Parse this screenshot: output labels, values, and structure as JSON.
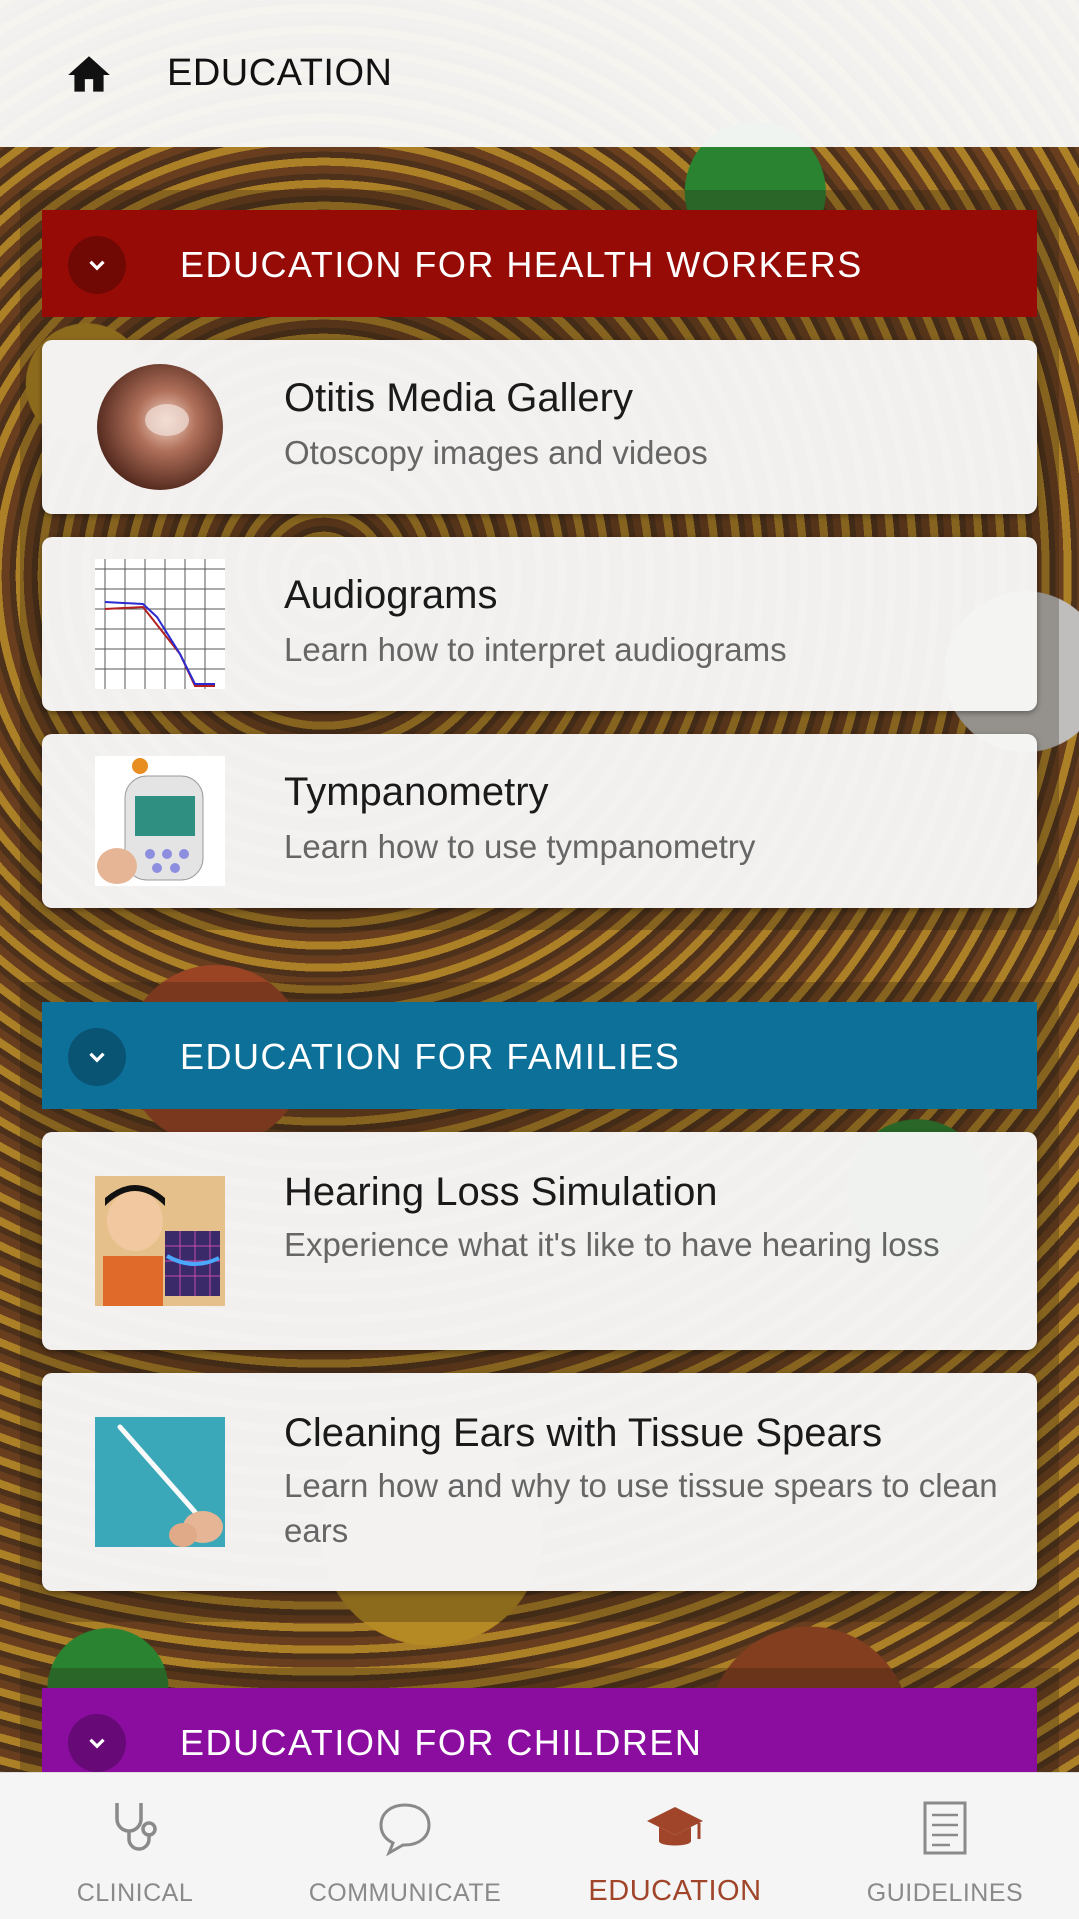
{
  "header": {
    "title": "EDUCATION",
    "home_icon": "home-icon"
  },
  "sections": [
    {
      "title": "EDUCATION FOR HEALTH WORKERS",
      "color": "#960b06",
      "items": [
        {
          "title": "Otitis Media Gallery",
          "subtitle": "Otoscopy images and videos",
          "thumb": "otoscopy-image"
        },
        {
          "title": "Audiograms",
          "subtitle": "Learn how to interpret audiograms",
          "thumb": "audiogram-image"
        },
        {
          "title": "Tympanometry",
          "subtitle": "Learn how to use tympanometry",
          "thumb": "tympanometer-image"
        }
      ]
    },
    {
      "title": "EDUCATION FOR FAMILIES",
      "color": "#0d7099",
      "items": [
        {
          "title": "Hearing Loss Simulation",
          "subtitle": "Experience what it's like to have hearing loss",
          "thumb": "cartoon-audiogram-image"
        },
        {
          "title": "Cleaning Ears with Tissue Spears",
          "subtitle": "Learn how and why to use tissue spears to clean ears",
          "thumb": "tissue-spear-image"
        }
      ]
    },
    {
      "title": "EDUCATION FOR CHILDREN",
      "color": "#8b0da0",
      "items": []
    }
  ],
  "nav": [
    {
      "label": "CLINICAL",
      "icon": "stethoscope-icon",
      "active": false
    },
    {
      "label": "COMMUNICATE",
      "icon": "chat-bubble-icon",
      "active": false
    },
    {
      "label": "EDUCATION",
      "icon": "graduation-cap-icon",
      "active": true
    },
    {
      "label": "GUIDELINES",
      "icon": "document-icon",
      "active": false
    }
  ],
  "colors": {
    "active_nav": "#a0452a",
    "inactive_nav": "#8a8a8a"
  }
}
